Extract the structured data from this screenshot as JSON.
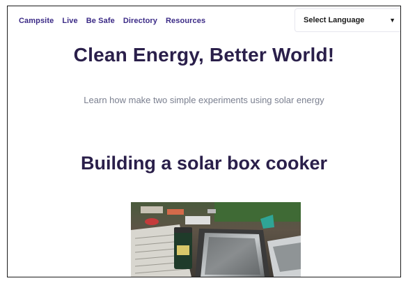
{
  "nav": {
    "items": [
      "Campsite",
      "Live",
      "Be Safe",
      "Directory",
      "Resources"
    ]
  },
  "language_select": {
    "label": "Select Language",
    "caret_icon": "caret-down-icon"
  },
  "hero": {
    "title": "Clean Energy, Better World!",
    "subtitle": "Learn how make two simple experiments using solar energy"
  },
  "section": {
    "heading": "Building a solar box cooker"
  },
  "colors": {
    "nav_text": "#3b2a86",
    "title_text": "#2a1f4a",
    "subtitle_text": "#7a7f8f"
  }
}
